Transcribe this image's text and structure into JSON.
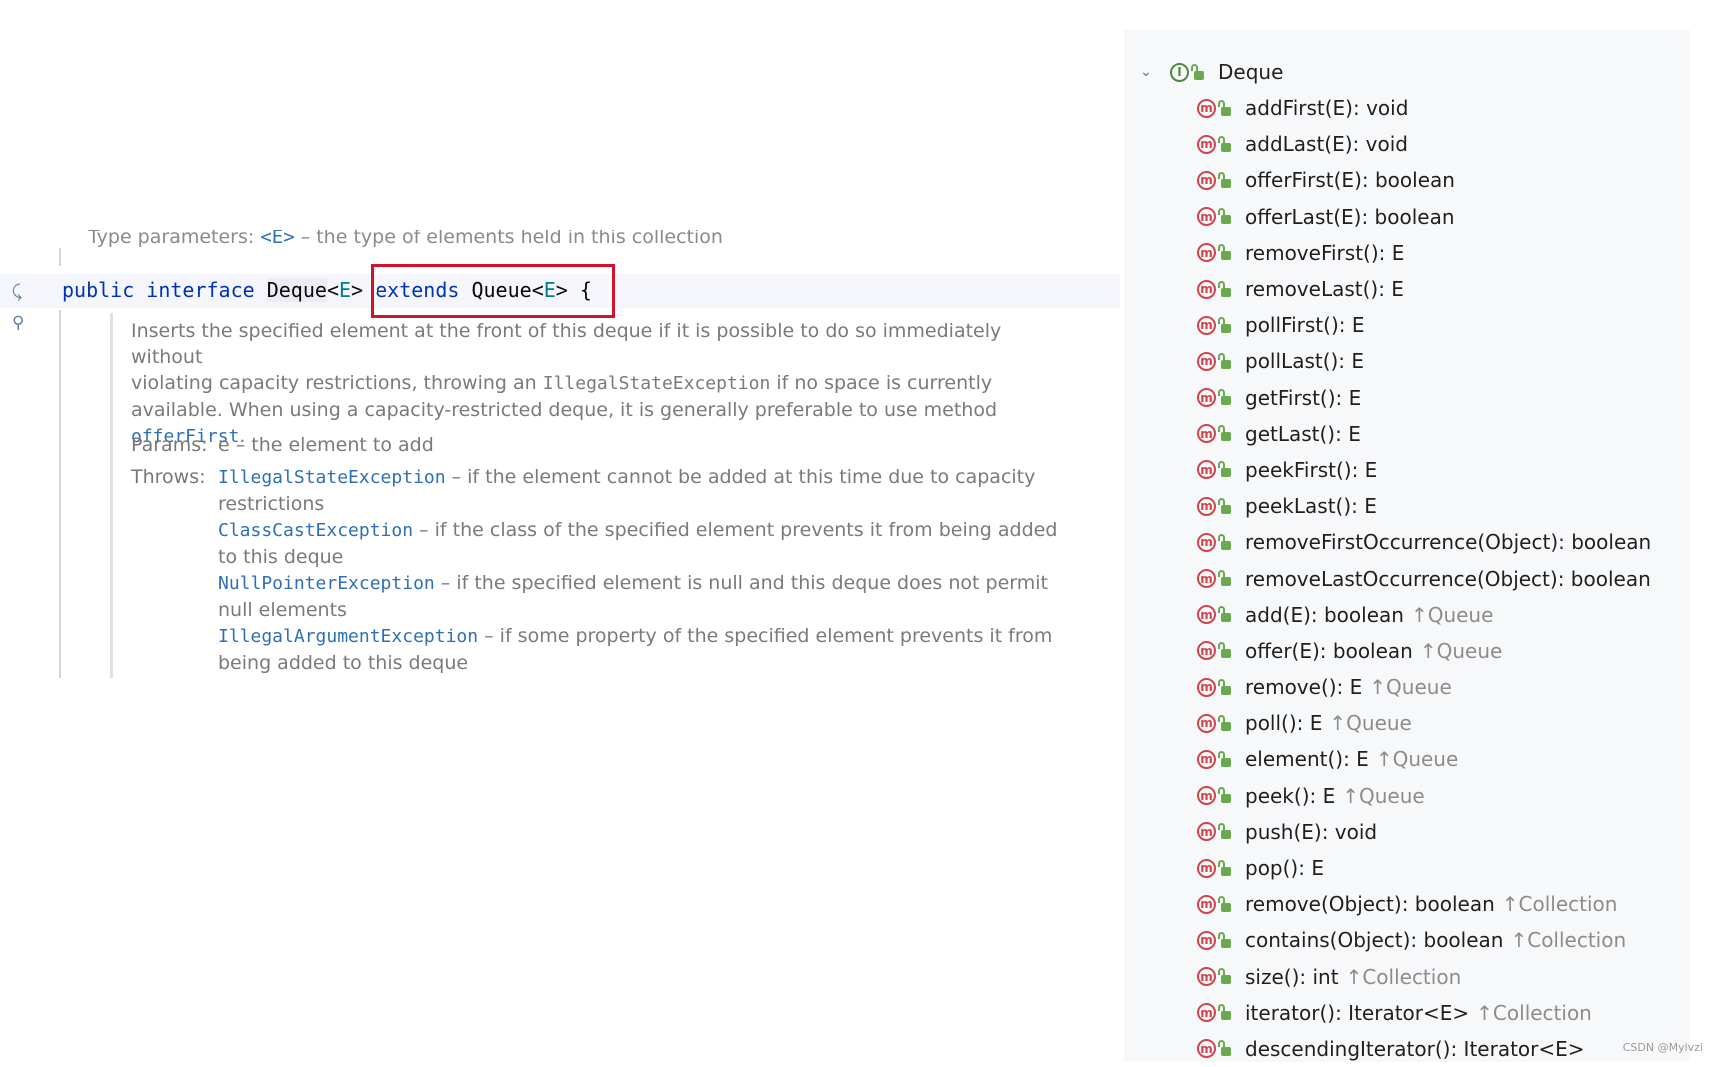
{
  "editor": {
    "prev_doc": {
      "text_before": "Type parameters: ",
      "code": "<E>",
      "text_after": " – the type of elements held in this collection"
    },
    "code_line": {
      "kw1": "public",
      "kw2": "interface",
      "name": "Deque",
      "lt1": "<",
      "type1": "E",
      "gt1": ">",
      "kw3": "extends",
      "name2": "Queue",
      "lt2": "<",
      "type2": "E",
      "gt2": ">",
      "brace": "{"
    },
    "doc": {
      "line1": "Inserts the specified element at the front of this deque if it is possible to do so immediately without",
      "line2_a": "violating capacity restrictions, throwing an ",
      "line2_code": "IllegalStateException",
      "line2_b": " if no space is currently",
      "line3": "available. When using a capacity-restricted deque, it is generally preferable to use method",
      "line4_code": "offerFirst",
      "line4_tail": ".",
      "params_label": "Params:",
      "params_value": "e – the element to add",
      "throws_label": "Throws:",
      "throws": [
        {
          "exception": "IllegalStateException",
          "text": " – if the element cannot be added at this time due to capacity restrictions"
        },
        {
          "exception": "ClassCastException",
          "text": " – if the class of the specified element prevents it from being added to this deque"
        },
        {
          "exception": "NullPointerException",
          "text": " – if the specified element is null and this deque does not permit null elements"
        },
        {
          "exception": "IllegalArgumentException",
          "text": " – if some property of the specified element prevents it from being added to this deque"
        }
      ]
    }
  },
  "structure": {
    "root": {
      "label": "Deque",
      "icon": "interface-icon"
    },
    "items": [
      {
        "label": "addFirst(E): void",
        "inherited": ""
      },
      {
        "label": "addLast(E): void",
        "inherited": ""
      },
      {
        "label": "offerFirst(E): boolean",
        "inherited": ""
      },
      {
        "label": "offerLast(E): boolean",
        "inherited": ""
      },
      {
        "label": "removeFirst(): E",
        "inherited": ""
      },
      {
        "label": "removeLast(): E",
        "inherited": ""
      },
      {
        "label": "pollFirst(): E",
        "inherited": ""
      },
      {
        "label": "pollLast(): E",
        "inherited": ""
      },
      {
        "label": "getFirst(): E",
        "inherited": ""
      },
      {
        "label": "getLast(): E",
        "inherited": ""
      },
      {
        "label": "peekFirst(): E",
        "inherited": ""
      },
      {
        "label": "peekLast(): E",
        "inherited": ""
      },
      {
        "label": "removeFirstOccurrence(Object): boolean",
        "inherited": ""
      },
      {
        "label": "removeLastOccurrence(Object): boolean",
        "inherited": ""
      },
      {
        "label": "add(E): boolean",
        "inherited": "↑Queue"
      },
      {
        "label": "offer(E): boolean",
        "inherited": "↑Queue"
      },
      {
        "label": "remove(): E",
        "inherited": "↑Queue"
      },
      {
        "label": "poll(): E",
        "inherited": "↑Queue"
      },
      {
        "label": "element(): E",
        "inherited": "↑Queue"
      },
      {
        "label": "peek(): E",
        "inherited": "↑Queue"
      },
      {
        "label": "push(E): void",
        "inherited": ""
      },
      {
        "label": "pop(): E",
        "inherited": ""
      },
      {
        "label": "remove(Object): boolean",
        "inherited": "↑Collection"
      },
      {
        "label": "contains(Object): boolean",
        "inherited": "↑Collection"
      },
      {
        "label": "size(): int",
        "inherited": "↑Collection"
      },
      {
        "label": "iterator(): Iterator<E>",
        "inherited": "↑Collection"
      },
      {
        "label": "descendingIterator(): Iterator<E>",
        "inherited": ""
      }
    ]
  },
  "watermark": "CSDN @Mylvzi",
  "colors": {
    "highlight_box": "#d5122b",
    "keyword": "#0033b3",
    "link": "#2f6fb5",
    "method_icon": "#d0454c",
    "interface_icon": "#4b8b3f"
  }
}
